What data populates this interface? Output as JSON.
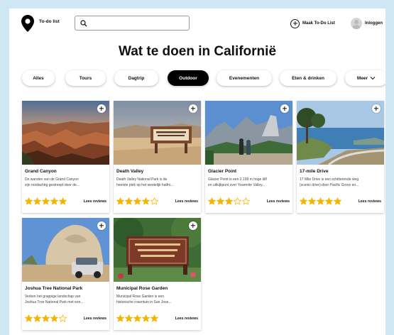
{
  "header": {
    "logo_text": "To-do list",
    "search_placeholder": "",
    "make_list_label": "Maak To-Do List",
    "login_label": "Inloggen"
  },
  "page_title": "Wat te doen in Californië",
  "tabs": [
    {
      "label": "Alles",
      "active": false
    },
    {
      "label": "Tours",
      "active": false
    },
    {
      "label": "Dagtrip",
      "active": false
    },
    {
      "label": "Outdoor",
      "active": true
    },
    {
      "label": "Evenementen",
      "active": false
    },
    {
      "label": "Eten & drinken",
      "active": false
    },
    {
      "label": "Meer",
      "active": false
    }
  ],
  "cards": [
    {
      "title": "Grand Canyon",
      "desc_1": "De wanden van de Grand Canyon",
      "desc_2": "zijn roodachtig gestreept door de...",
      "rating": 5,
      "reviews_label": "Lees reviews"
    },
    {
      "title": "Death Valley",
      "desc_1": "Death Valley National Park is de",
      "desc_2": "heetste plek op het westelijk halfro...",
      "rating": 4,
      "reviews_label": "Lees reviews"
    },
    {
      "title": "Glacier Point",
      "desc_1": "Glacier Point is een 2.199 m hoge klif",
      "desc_2": "en uitkijkpunt over Yosemite Valley...",
      "rating": 3,
      "reviews_label": "Lees reviews"
    },
    {
      "title": "17-mile Drive",
      "desc_1": "17 Mile Drive is een schitterende weg",
      "desc_2": "(scenic drive) door Pacific Grove en...",
      "rating": 5,
      "reviews_label": "Lees reviews"
    },
    {
      "title": "Joshua Tree National Park",
      "desc_1": "Verken het grappige landschap van",
      "desc_2": "Joshua Tree National Park met een...",
      "rating": 4,
      "reviews_label": "Lees reviews"
    },
    {
      "title": "Municipal Rose Garden",
      "desc_1": "Municipal Rose Garden is een",
      "desc_2": "historische rosentuin in San Jose...",
      "rating": 5,
      "reviews_label": "Lees reviews"
    }
  ],
  "colors": {
    "background": "#cfe7f3",
    "star": "#f4b400",
    "active_tab": "#000000"
  },
  "icons": {
    "logo": "map-pin-icon",
    "search": "search-icon",
    "make_list": "plus-circle-icon",
    "login": "avatar-icon",
    "card_add": "plus-icon",
    "rating": "star-icon",
    "more": "chevron-down-icon"
  }
}
